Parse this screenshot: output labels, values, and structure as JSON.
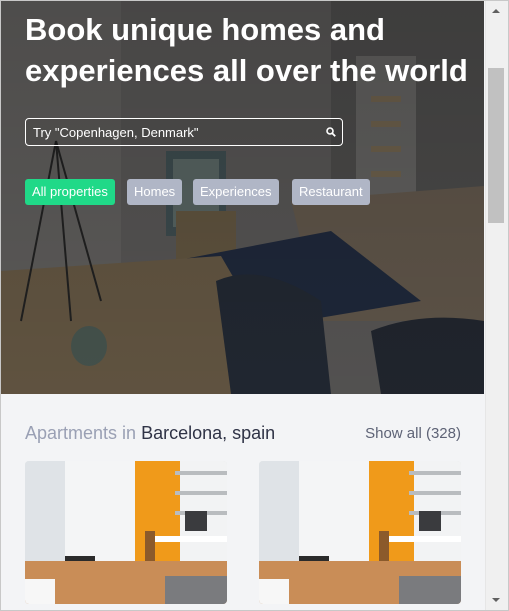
{
  "hero": {
    "title": "Book unique homes and experiences all over the world"
  },
  "search": {
    "placeholder": "Try \"Copenhagen, Denmark\"",
    "icon": "search-icon"
  },
  "filters": [
    {
      "label": "All properties",
      "active": true
    },
    {
      "label": "Homes",
      "active": false
    },
    {
      "label": "Experiences",
      "active": false
    },
    {
      "label": "Restaurant",
      "active": false
    }
  ],
  "section": {
    "title_prefix": "Apartments in",
    "title_place": "Barcelona, spain",
    "show_all": "Show all (328)"
  },
  "colors": {
    "accent": "#20d988",
    "chip": "#b0b6c6",
    "muted_text": "#9aa0b4",
    "dark_text": "#2f3346"
  }
}
